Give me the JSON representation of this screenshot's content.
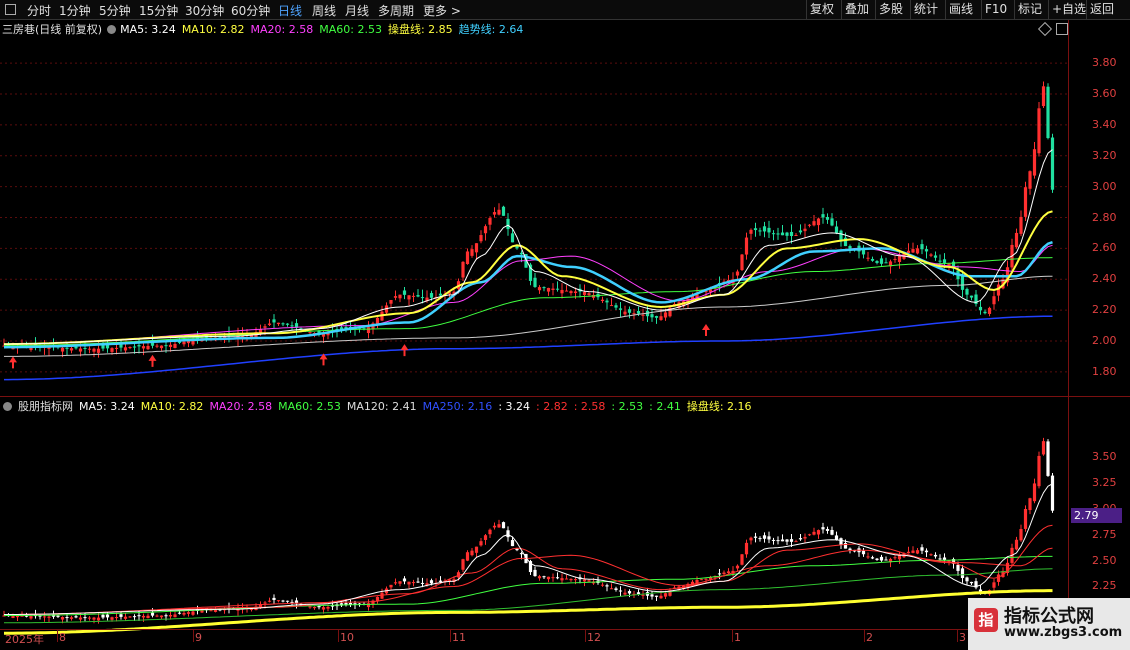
{
  "toolbar": {
    "left": [
      "分时",
      "1分钟",
      "5分钟",
      "15分钟",
      "30分钟",
      "60分钟",
      "日线",
      "周线",
      "月线",
      "多周期",
      "更多 >"
    ],
    "active": "日线",
    "right": [
      "复权",
      "叠加",
      "多股",
      "统计",
      "画线",
      "F10",
      "标记",
      "+自选",
      "返回"
    ]
  },
  "main_info": {
    "title": "三房巷(日线 前复权)",
    "ma5": "MA5: 3.24",
    "ma10": "MA10: 2.82",
    "ma20": "MA20: 2.58",
    "ma60": "MA60: 2.53",
    "caopan": "操盘线: 2.85",
    "trend": "趋势线: 2.64"
  },
  "sub_info": {
    "title": "股朋指标网",
    "ma5": "MA5: 3.24",
    "ma10": "MA10: 2.82",
    "ma20": "MA20: 2.58",
    "ma60": "MA60: 2.53",
    "ma120": "MA120: 2.41",
    "ma250": "MA250: 2.16",
    "v1": ": 3.24",
    "v2": ": 2.82",
    "v3": ": 2.58",
    "v4": ": 2.53",
    "v5": ": 2.41",
    "caopan": "操盘线: 2.16"
  },
  "price_box": "2.79",
  "xaxis": {
    "year": "2025年",
    "months": [
      "8",
      "9",
      "10",
      "11",
      "12",
      "1",
      "2",
      "3"
    ]
  },
  "watermark": {
    "logo": "指",
    "line1": "指标公式网",
    "line2": "www.zbgs3.com"
  },
  "colors": {
    "up": "#ff3030",
    "down": "#20e0a0",
    "ma5": "#ffffff",
    "ma10": "#ffff40",
    "ma20": "#ff40ff",
    "ma60": "#40ff40",
    "ma120": "#cccccc",
    "ma250": "#2040ff",
    "trend": "#40d0ff"
  },
  "chart_data": [
    {
      "type": "candlestick",
      "title": "三房巷(日线 前复权)",
      "ylim": [
        1.65,
        3.95
      ],
      "yticks": [
        "3.80",
        "3.60",
        "3.40",
        "3.20",
        "3.00",
        "2.80",
        "2.60",
        "2.40",
        "2.20",
        "2.00",
        "1.80"
      ],
      "anchors_close": [
        [
          0,
          1.97
        ],
        [
          20,
          1.95
        ],
        [
          35,
          1.97
        ],
        [
          45,
          2.02
        ],
        [
          55,
          2.05
        ],
        [
          60,
          2.12
        ],
        [
          70,
          2.05
        ],
        [
          80,
          2.08
        ],
        [
          88,
          2.3
        ],
        [
          95,
          2.28
        ],
        [
          100,
          2.32
        ],
        [
          103,
          2.58
        ],
        [
          110,
          2.85
        ],
        [
          114,
          2.6
        ],
        [
          118,
          2.35
        ],
        [
          128,
          2.32
        ],
        [
          140,
          2.18
        ],
        [
          145,
          2.15
        ],
        [
          150,
          2.25
        ],
        [
          155,
          2.32
        ],
        [
          162,
          2.4
        ],
        [
          166,
          2.72
        ],
        [
          175,
          2.68
        ],
        [
          182,
          2.8
        ],
        [
          188,
          2.6
        ],
        [
          195,
          2.5
        ],
        [
          203,
          2.6
        ],
        [
          210,
          2.5
        ],
        [
          214,
          2.3
        ],
        [
          218,
          2.18
        ],
        [
          222,
          2.4
        ],
        [
          225,
          2.7
        ],
        [
          228,
          3.1
        ],
        [
          231,
          3.65
        ],
        [
          233,
          2.98
        ]
      ],
      "anchors_ma5": [
        [
          0,
          1.98
        ],
        [
          50,
          2.03
        ],
        [
          70,
          2.08
        ],
        [
          88,
          2.22
        ],
        [
          100,
          2.3
        ],
        [
          106,
          2.55
        ],
        [
          112,
          2.75
        ],
        [
          118,
          2.45
        ],
        [
          130,
          2.32
        ],
        [
          146,
          2.2
        ],
        [
          160,
          2.3
        ],
        [
          170,
          2.62
        ],
        [
          184,
          2.7
        ],
        [
          200,
          2.55
        ],
        [
          216,
          2.25
        ],
        [
          224,
          2.55
        ],
        [
          233,
          3.24
        ]
      ],
      "anchors_ma10": [
        [
          0,
          1.98
        ],
        [
          60,
          2.05
        ],
        [
          90,
          2.18
        ],
        [
          104,
          2.38
        ],
        [
          114,
          2.62
        ],
        [
          124,
          2.42
        ],
        [
          146,
          2.22
        ],
        [
          160,
          2.3
        ],
        [
          174,
          2.6
        ],
        [
          190,
          2.66
        ],
        [
          210,
          2.48
        ],
        [
          220,
          2.33
        ],
        [
          233,
          2.84
        ]
      ],
      "anchors_ma20": [
        [
          0,
          1.98
        ],
        [
          80,
          2.1
        ],
        [
          100,
          2.25
        ],
        [
          115,
          2.52
        ],
        [
          126,
          2.55
        ],
        [
          150,
          2.26
        ],
        [
          170,
          2.45
        ],
        [
          190,
          2.6
        ],
        [
          213,
          2.48
        ],
        [
          226,
          2.45
        ],
        [
          233,
          2.62
        ]
      ],
      "anchors_ma60": [
        [
          0,
          1.97
        ],
        [
          90,
          2.08
        ],
        [
          120,
          2.28
        ],
        [
          150,
          2.32
        ],
        [
          180,
          2.45
        ],
        [
          205,
          2.5
        ],
        [
          233,
          2.54
        ]
      ],
      "anchors_ma120": [
        [
          0,
          1.9
        ],
        [
          100,
          2.02
        ],
        [
          160,
          2.22
        ],
        [
          210,
          2.36
        ],
        [
          233,
          2.42
        ]
      ],
      "anchors_ma250": [
        [
          0,
          1.75
        ],
        [
          100,
          1.95
        ],
        [
          160,
          2.0
        ],
        [
          233,
          2.16
        ]
      ],
      "anchors_trend": [
        [
          0,
          1.96
        ],
        [
          60,
          2.02
        ],
        [
          90,
          2.12
        ],
        [
          106,
          2.38
        ],
        [
          114,
          2.55
        ],
        [
          126,
          2.48
        ],
        [
          146,
          2.25
        ],
        [
          165,
          2.4
        ],
        [
          180,
          2.58
        ],
        [
          195,
          2.6
        ],
        [
          215,
          2.42
        ],
        [
          225,
          2.42
        ],
        [
          233,
          2.64
        ]
      ]
    },
    {
      "type": "candlestick",
      "title": "股朋指标网",
      "ylim": [
        1.85,
        3.95
      ],
      "yticks": [
        "3.50",
        "3.25",
        "3.00",
        "2.75",
        "2.50",
        "2.25"
      ]
    }
  ]
}
